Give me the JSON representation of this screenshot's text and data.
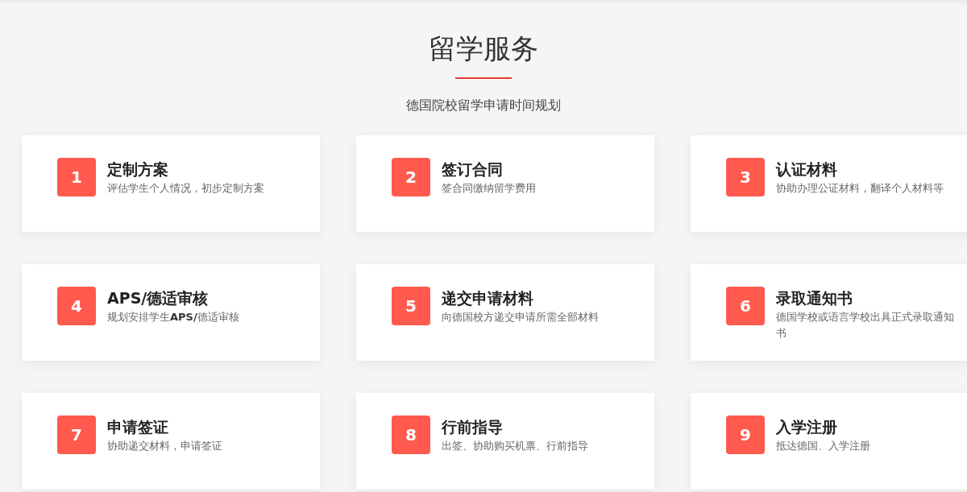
{
  "header": {
    "title": "留学服务",
    "subtitle": "德国院校留学申请时间规划"
  },
  "steps": [
    {
      "number": "1",
      "title": "定制方案",
      "description": "评估学生个人情况，初步定制方案"
    },
    {
      "number": "2",
      "title": "签订合同",
      "description": "签合同缴纳留学费用"
    },
    {
      "number": "3",
      "title": "认证材料",
      "description": "协助办理公证材料，翻译个人材料等"
    },
    {
      "number": "4",
      "title": "APS/德适审核",
      "description": "规划安排学生**APS/**德适审核"
    },
    {
      "number": "5",
      "title": "递交申请材料",
      "description": "向德国校方递交申请所需全部材料"
    },
    {
      "number": "6",
      "title": "录取通知书",
      "description": "德国学校或语言学校出具正式录取通知书"
    },
    {
      "number": "7",
      "title": "申请签证",
      "description": "协助递交材料，申请签证"
    },
    {
      "number": "8",
      "title": "行前指导",
      "description": "出签、协助购买机票、行前指导"
    },
    {
      "number": "9",
      "title": "入学注册",
      "description": "抵达德国、入学注册"
    }
  ]
}
